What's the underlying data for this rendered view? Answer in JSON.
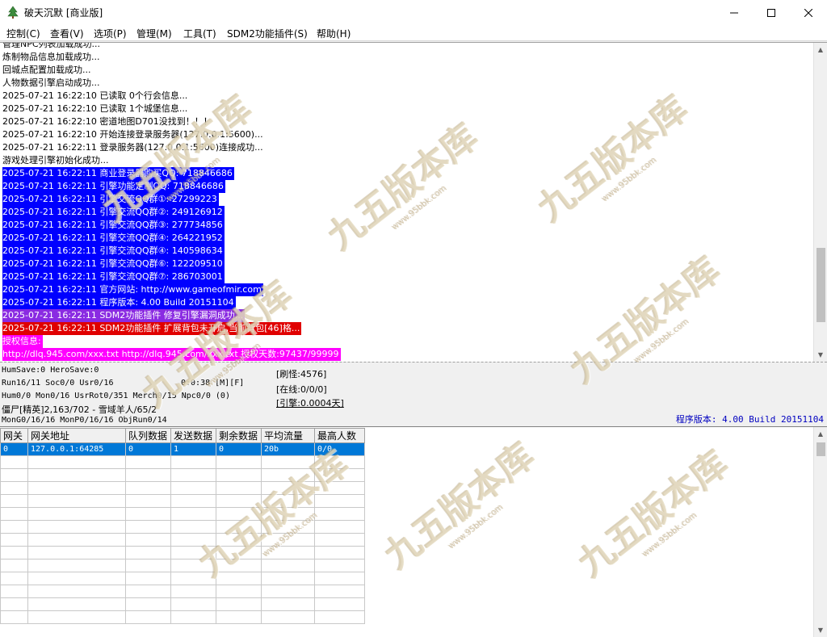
{
  "window": {
    "title": "破天沉默 [商业版]",
    "icons": {
      "app": "tree-icon",
      "minimize": "minimize-icon",
      "maximize": "maximize-icon",
      "close": "close-icon"
    }
  },
  "menu": [
    "控制(C)",
    "查看(V)",
    "选项(P)",
    "管理(M)",
    "工具(T)",
    "SDM2功能插件(S)",
    "帮助(H)"
  ],
  "log": {
    "lines": [
      "管理NPC列表加载成功...",
      "炼制物品信息加载成功...",
      "回城点配置加载成功...",
      "人物数据引擎启动成功...",
      "2025-07-21 16:22:10 已读取 0个行会信息...",
      "2025-07-21 16:22:10 已读取 1个城堡信息...",
      "2025-07-21 16:22:10 密道地图D701没找到！！！",
      "2025-07-21 16:22:10 开始连接登录服务器(127.0.0.1:5600)...",
      "2025-07-21 16:22:11 登录服务器(127.0.0.1:5600)连接成功...",
      "游戏处理引擎初始化成功...",
      "2025-07-21 16:22:11 商业登录器购买QQ: 718846686",
      "2025-07-21 16:22:11 引擎功能定制QQ: 718846686",
      "2025-07-21 16:22:11 引擎交流QQ群①: 27299223",
      "2025-07-21 16:22:11 引擎交流QQ群②: 249126912",
      "2025-07-21 16:22:11 引擎交流QQ群③: 277734856",
      "2025-07-21 16:22:11 引擎交流QQ群④: 264221952",
      "2025-07-21 16:22:11 引擎交流QQ群④: 140598634",
      "2025-07-21 16:22:11 引擎交流QQ群⑥: 122209510",
      "2025-07-21 16:22:11 引擎交流QQ群⑦: 286703001",
      "2025-07-21 16:22:11 官方网站: http://www.gameofmir.com",
      "2025-07-21 16:22:11 程序版本: 4.00 Build 20151104",
      "2025-07-21 16:22:11 SDM2功能插件 修复引擎漏洞成功...",
      "2025-07-21 16:22:11 SDM2功能插件 扩展背包未开启,当前背包[46]格...",
      "授权信息:",
      "http://dlq.945.com/xxx.txt http://dlq.945.com/xxx.txt 授权天数:97437/99999"
    ]
  },
  "status": {
    "hum_save": "HumSave:0 HeroSave:0",
    "run": "Run16/11 Soc0/0 Usr0/16",
    "time": "0:0:38 [M][F]",
    "hum": "Hum0/0 Mon0/16 UsrRot0/351 Merch0/15 Npc0/0 (0)",
    "monster": "僵尸[精英]2,163/702 - 雪域羊人/65/2",
    "mon_gen": "MonG0/16/16 MonP0/16/16 ObjRun0/14",
    "refresh": "[刷怪:4576]",
    "online": "[在线:0/0/0]",
    "engine": "[引擎:0.0004天]",
    "version": "程序版本: 4.00 Build 20151104"
  },
  "gateway": {
    "columns": [
      "网关",
      "网关地址",
      "队列数据",
      "发送数据",
      "剩余数据",
      "平均流量",
      "最高人数"
    ],
    "rows": [
      [
        "0",
        "127.0.0.1:64285",
        "0",
        "1",
        "0",
        "20b",
        "0/0"
      ]
    ],
    "empty_rows": 13
  },
  "watermark": {
    "text": "九五版本库",
    "sub": "www.95bbk.com"
  }
}
